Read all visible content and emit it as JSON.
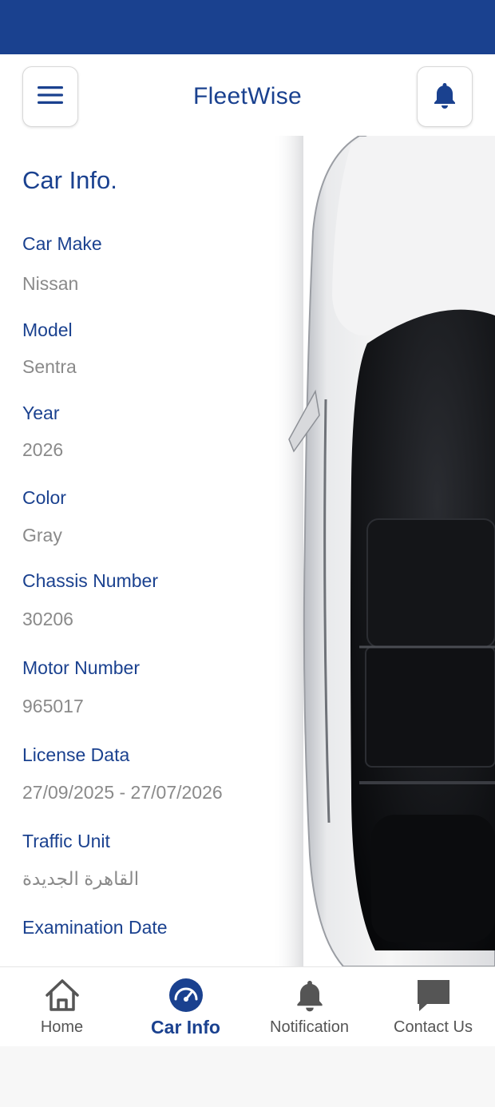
{
  "colors": {
    "brand": "#1a418f",
    "value_text": "#8a8a8a",
    "nav_inactive": "#555555"
  },
  "header": {
    "title": "FleetWise",
    "menu_icon": "hamburger-menu-icon",
    "notification_icon": "bell-icon"
  },
  "car_info": {
    "title": "Car Info.",
    "fields": [
      {
        "label": "Car Make",
        "value": "Nissan"
      },
      {
        "label": "Model",
        "value": "Sentra"
      },
      {
        "label": "Year",
        "value": "2026"
      },
      {
        "label": "Color",
        "value": "Gray"
      },
      {
        "label": "Chassis Number",
        "value": "30206"
      },
      {
        "label": "Motor Number",
        "value": "965017"
      },
      {
        "label": "License Data",
        "value": "27/09/2025 - 27/07/2026"
      },
      {
        "label": "Traffic Unit",
        "value": "القاهرة الجديدة"
      },
      {
        "label": "Examination Date",
        "value": ""
      }
    ]
  },
  "bottom_nav": {
    "active": "Car Info",
    "items": [
      {
        "label": "Home",
        "icon": "home-icon"
      },
      {
        "label": "Car Info",
        "icon": "speedometer-icon"
      },
      {
        "label": "Notification",
        "icon": "bell-icon"
      },
      {
        "label": "Contact Us",
        "icon": "chat-bubble-icon"
      }
    ]
  }
}
